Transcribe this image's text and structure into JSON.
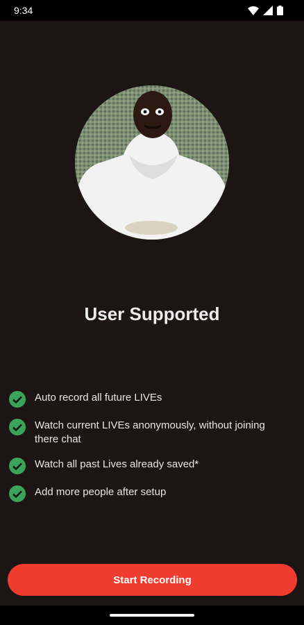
{
  "status_bar": {
    "time": "9:34",
    "icons": [
      "wifi-icon",
      "signal-icon",
      "battery-icon"
    ]
  },
  "profile": {
    "image": "profile-photo",
    "title": "User Supported"
  },
  "features": [
    "Auto record all future LIVEs",
    "Watch current LIVEs anonymously, without joining there chat",
    "Watch all past Lives already saved*",
    "Add more people after setup"
  ],
  "cta": {
    "label": "Start Recording"
  },
  "colors": {
    "background": "#1d1414",
    "accent": "#f03c2e",
    "check": "#3aa45a"
  }
}
